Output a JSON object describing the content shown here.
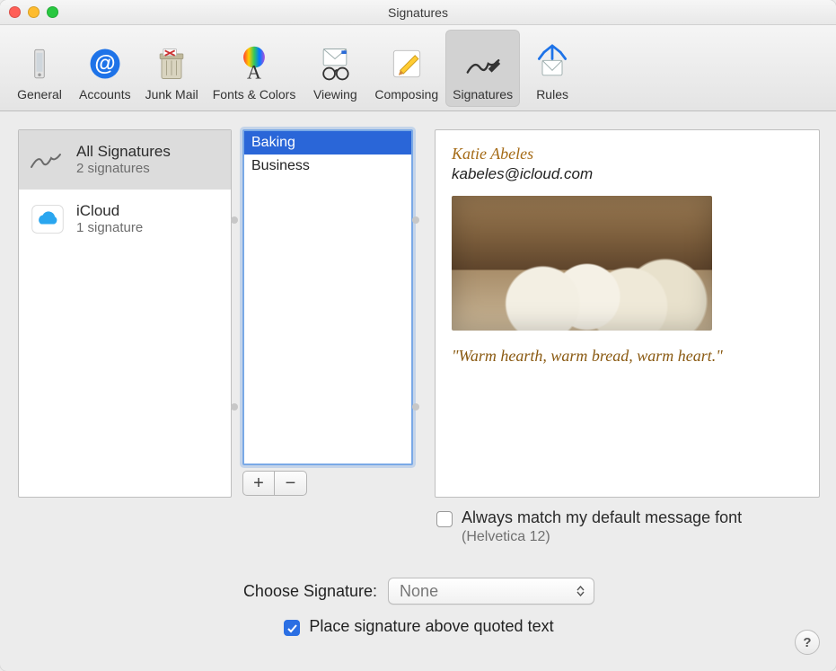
{
  "window": {
    "title": "Signatures"
  },
  "toolbar": {
    "items": [
      {
        "label": "General"
      },
      {
        "label": "Accounts"
      },
      {
        "label": "Junk Mail"
      },
      {
        "label": "Fonts & Colors"
      },
      {
        "label": "Viewing"
      },
      {
        "label": "Composing"
      },
      {
        "label": "Signatures"
      },
      {
        "label": "Rules"
      }
    ],
    "selected_index": 6
  },
  "accounts": [
    {
      "title": "All Signatures",
      "subtitle": "2 signatures",
      "selected": true
    },
    {
      "title": "iCloud",
      "subtitle": "1 signature",
      "selected": false
    }
  ],
  "signatures": {
    "items": [
      {
        "name": "Baking",
        "selected": true
      },
      {
        "name": "Business",
        "selected": false
      }
    ]
  },
  "buttons": {
    "add": "+",
    "remove": "−"
  },
  "preview": {
    "name": "Katie Abeles",
    "email": "kabeles@icloud.com",
    "quote": "\"Warm hearth, warm bread, warm heart.\""
  },
  "match_font": {
    "label": "Always match my default message font",
    "note": "(Helvetica 12)",
    "checked": false
  },
  "choose": {
    "label": "Choose Signature:",
    "value": "None"
  },
  "place_above": {
    "label": "Place signature above quoted text",
    "checked": true
  },
  "help": {
    "label": "?"
  }
}
